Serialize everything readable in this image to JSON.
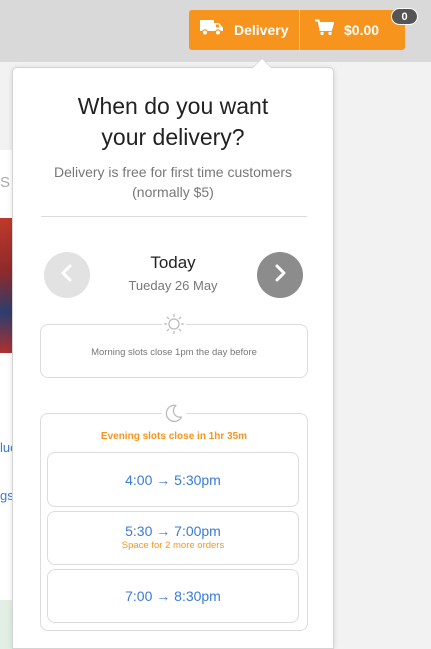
{
  "header": {
    "delivery_label": "Delivery",
    "cart_total": "$0.00",
    "cart_count": "0",
    "accent_color": "#f7941d"
  },
  "background": {
    "letter_s": "S",
    "link_1": "luc",
    "link_2": "gs"
  },
  "popover": {
    "title_line1": "When do you want",
    "title_line2": "your delivery?",
    "subtitle_line1": "Delivery is free for first time customers",
    "subtitle_line2": "(normally $5)",
    "day": "Today",
    "date": "Tueday 26 May",
    "morning": {
      "icon": "sun-icon",
      "note": "Morning slots close 1pm the day before"
    },
    "evening": {
      "icon": "moon-icon",
      "note": "Evening slots close in 1hr 35m",
      "slots": [
        {
          "time": "4:00 → 5:30pm",
          "note": ""
        },
        {
          "time": "5:30 → 7:00pm",
          "note": "Space for 2 more orders"
        },
        {
          "time": "7:00 → 8:30pm",
          "note": ""
        }
      ]
    }
  }
}
